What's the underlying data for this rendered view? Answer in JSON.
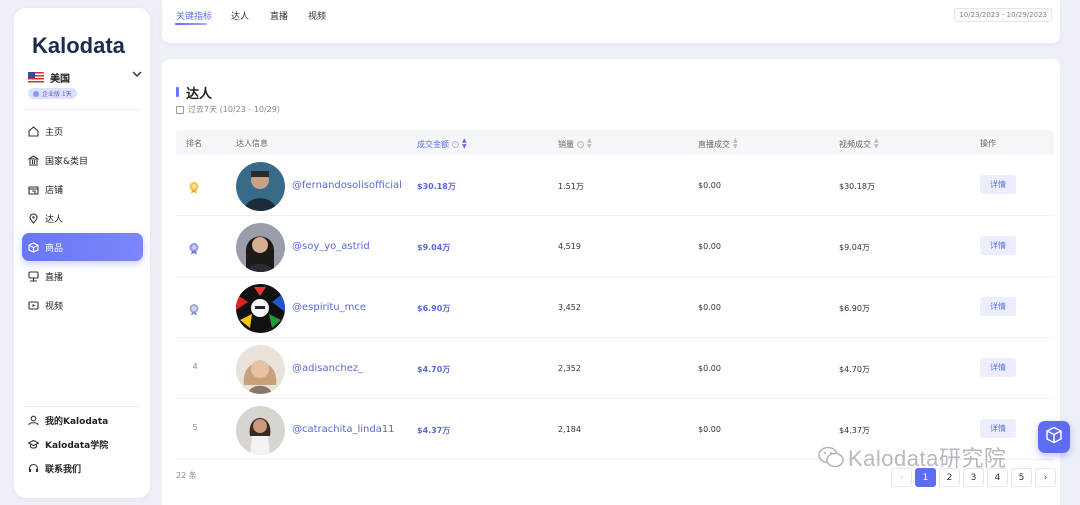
{
  "sidebar": {
    "logo": "Kalodata",
    "region": "美国",
    "plan": "企业版 1天",
    "nav": [
      {
        "label": "主页",
        "icon": "home-icon"
      },
      {
        "label": "国家&类目",
        "icon": "bank-icon"
      },
      {
        "label": "店铺",
        "icon": "store-icon"
      },
      {
        "label": "达人",
        "icon": "location-pin-icon"
      },
      {
        "label": "商品",
        "icon": "cube-icon"
      },
      {
        "label": "直播",
        "icon": "people-icon"
      },
      {
        "label": "视频",
        "icon": "video-icon"
      }
    ],
    "active_index": 4,
    "bottom": [
      {
        "label": "我的Kalodata",
        "icon": "user-icon"
      },
      {
        "label": "Kalodata学院",
        "icon": "graduation-cap-icon"
      },
      {
        "label": "联系我们",
        "icon": "headset-icon"
      }
    ]
  },
  "topbar": {
    "tabs": [
      "关键指标",
      "达人",
      "直播",
      "视频"
    ],
    "active_tab": "关键指标",
    "date_range": "10/23/2023 - 10/29/2023"
  },
  "section": {
    "title": "达人",
    "period": "过去7天 (10/23 - 10/29)"
  },
  "table": {
    "columns": [
      "排名",
      "达人信息",
      "成交金额",
      "销量",
      "直播成交",
      "视频成交",
      "操作"
    ],
    "rows": [
      {
        "rank": "1",
        "handle": "@fernandosolisofficial",
        "gmv": "$30.18万",
        "sales": "1.51万",
        "live": "$0.00",
        "video": "$30.18万",
        "action": "详情"
      },
      {
        "rank": "2",
        "handle": "@soy_yo_astrid",
        "gmv": "$9.04万",
        "sales": "4,519",
        "live": "$0.00",
        "video": "$9.04万",
        "action": "详情"
      },
      {
        "rank": "3",
        "handle": "@espiritu_mce",
        "gmv": "$6.90万",
        "sales": "3,452",
        "live": "$0.00",
        "video": "$6.90万",
        "action": "详情"
      },
      {
        "rank": "4",
        "handle": "@adisanchez_",
        "gmv": "$4.70万",
        "sales": "2,352",
        "live": "$0.00",
        "video": "$4.70万",
        "action": "详情"
      },
      {
        "rank": "5",
        "handle": "@catrachita_linda11",
        "gmv": "$4.37万",
        "sales": "2,184",
        "live": "$0.00",
        "video": "$4.37万",
        "action": "详情"
      }
    ],
    "total": "22 条"
  },
  "pagination": {
    "prev": "‹",
    "pages": [
      "1",
      "2",
      "3",
      "4",
      "5"
    ],
    "current": "1",
    "next": "›"
  },
  "watermark": "Kalodata研究院",
  "colors": {
    "accent": "#5d6cf0",
    "gold": "#f0b429",
    "silver": "#8f97e8"
  }
}
